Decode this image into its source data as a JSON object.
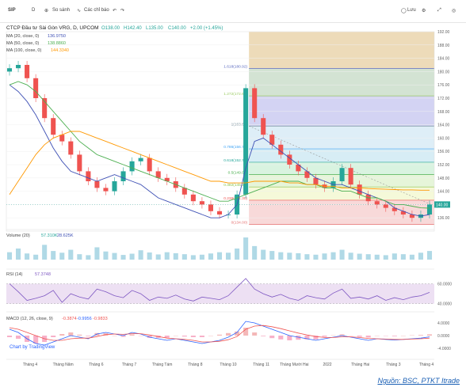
{
  "toolbar": {
    "symbol": "SIP",
    "interval": "D",
    "compare": "So sánh",
    "indicators": "Các chỉ báo",
    "save": "Lưu"
  },
  "chart_data": [
    {
      "type": "line",
      "title": "CTCP Đầu tư Sài Gòn VRG, D, UPCOM",
      "ohlc": {
        "open": "O138.00",
        "high": "H142.40",
        "low": "L135.00",
        "close": "C140.00",
        "change": "+2.00 (+1.45%)"
      },
      "ma_labels": [
        {
          "name": "MA (20, close, 0)",
          "value": "136.9750",
          "color": "#3f51b5"
        },
        {
          "name": "MA (50, close, 0)",
          "value": "138.8860",
          "color": "#4caf50"
        },
        {
          "name": "MA (100, close, 0)",
          "value": "144.3340",
          "color": "#ff9800"
        }
      ],
      "x_labels": [
        "Tháng 4",
        "Tháng Năm",
        "Tháng 6",
        "Tháng 7",
        "Tháng Tám",
        "Tháng 8",
        "Tháng 10",
        "Tháng 11",
        "Tháng Mười Hai",
        "2022",
        "Tháng Hai",
        "Tháng 3",
        "Tháng 4"
      ],
      "ylim": [
        132,
        192
      ],
      "y_ticks": [
        136,
        140,
        144,
        148,
        152,
        156,
        160,
        164,
        168,
        172,
        176,
        180,
        184,
        188,
        192
      ],
      "last_price_label": "140.00",
      "series": [
        {
          "name": "MA (20, close, 0)",
          "color": "#3f51b5",
          "values": [
            176,
            174,
            171,
            167,
            162,
            157,
            153,
            150,
            149,
            148,
            147,
            148,
            149,
            148,
            147,
            146,
            144,
            142,
            141,
            140,
            139,
            138,
            137,
            136,
            136,
            137,
            140,
            151,
            159,
            160,
            158,
            156,
            154,
            152,
            150,
            148,
            147,
            146,
            146,
            145,
            144,
            143,
            142,
            141,
            139,
            138,
            137,
            136.5,
            137
          ]
        },
        {
          "name": "MA (50, close, 0)",
          "color": "#4caf50",
          "values": [
            176,
            177,
            176,
            174,
            171,
            168,
            165,
            162,
            159,
            157,
            155,
            154,
            153,
            152,
            151,
            150,
            149,
            148,
            147,
            146,
            145,
            144,
            143,
            142,
            141,
            141,
            142,
            143,
            144,
            145,
            146,
            147,
            147,
            147,
            146,
            146,
            145,
            145,
            144,
            144,
            143,
            142,
            142,
            141,
            140,
            140,
            139.5,
            139,
            138.9
          ]
        },
        {
          "name": "MA (100, close, 0)",
          "color": "#ff9800",
          "values": [
            143,
            147,
            151,
            155,
            158,
            160,
            161,
            162,
            162,
            161,
            160,
            159,
            158,
            157,
            156,
            155,
            154,
            153,
            152,
            151,
            150,
            149,
            148,
            147,
            147,
            146.5,
            146.5,
            146.5,
            147,
            147,
            147,
            147,
            146.5,
            146.5,
            146,
            146,
            145.5,
            145.5,
            145,
            145,
            145,
            144.8,
            144.7,
            144.6,
            144.5,
            144.4,
            144.4,
            144.3,
            144.3
          ]
        }
      ],
      "close_path": [
        181,
        182,
        178,
        172,
        166,
        161,
        159,
        155,
        150,
        147,
        145,
        144,
        147,
        150,
        153,
        154,
        150,
        148,
        147,
        145,
        143,
        141,
        140,
        138,
        137,
        137,
        143,
        175,
        166,
        161,
        158,
        155,
        152,
        150,
        148,
        146,
        145,
        147,
        151,
        146,
        143,
        141,
        140,
        139,
        138,
        137,
        136,
        137,
        140
      ],
      "fibonacci": [
        {
          "label": "1.618(180.92)",
          "value": 180.92,
          "color": "#5c6bc0"
        },
        {
          "label": "1.272(172.69)",
          "value": 172.69,
          "color": "#9ccc65"
        },
        {
          "label": "1(163.60)",
          "value": 163.6,
          "color": "#78909c"
        },
        {
          "label": "0.786(156.75)",
          "value": 156.75,
          "color": "#42a5f5"
        },
        {
          "label": "0.618(152.73)",
          "value": 152.73,
          "color": "#26a69a"
        },
        {
          "label": "0.5(149.00)",
          "value": 149.0,
          "color": "#4caf50"
        },
        {
          "label": "0.382(145.29)",
          "value": 145.29,
          "color": "#8bc34a"
        },
        {
          "label": "0.236(141.30)",
          "value": 141.3,
          "color": "#ef5350"
        },
        {
          "label": "0(134.00)",
          "value": 134.0,
          "color": "#e57373"
        }
      ],
      "fib_top_value": 192,
      "volume": {
        "label": "Volume (20)",
        "value1": "57.310K",
        "value2": "28.625K",
        "bars": [
          30,
          45,
          25,
          20,
          60,
          35,
          28,
          40,
          22,
          18,
          50,
          33,
          27,
          19,
          24,
          38,
          29,
          21,
          30,
          26,
          22,
          18,
          20,
          25,
          30,
          28,
          45,
          90,
          55,
          40,
          35,
          30,
          28,
          26,
          22,
          20,
          25,
          30,
          40,
          28,
          24,
          22,
          20,
          18,
          25,
          22,
          20,
          28,
          35
        ]
      },
      "rsi": {
        "label": "RSI (14)",
        "value": "57.3748",
        "levels": [
          70.0,
          40.0
        ],
        "level_labels": [
          "60.0000",
          "40.0000"
        ],
        "values": [
          70,
          58,
          45,
          48,
          52,
          60,
          42,
          55,
          50,
          47,
          62,
          58,
          52,
          49,
          60,
          55,
          45,
          50,
          48,
          53,
          47,
          44,
          50,
          48,
          46,
          52,
          65,
          78,
          62,
          55,
          50,
          54,
          48,
          45,
          52,
          49,
          47,
          56,
          62,
          48,
          50,
          47,
          52,
          45,
          49,
          46,
          50,
          52,
          57
        ]
      },
      "macd": {
        "label": "MACD (12, 26, close, 9)",
        "macd": "-0.3874",
        "signal": "-0.9956",
        "hist": "-0.9833",
        "y_labels": [
          "4.0000",
          "0.0000",
          "-4.0000"
        ],
        "macd_values": [
          2,
          1,
          -1,
          -2.5,
          -3,
          -2,
          -1,
          0,
          -0.5,
          -1,
          0.5,
          1,
          0.5,
          0,
          1,
          0.5,
          -0.5,
          -1,
          -1.5,
          -1,
          -1.5,
          -2,
          -2.5,
          -2,
          -1.5,
          -0.5,
          1,
          4.5,
          4,
          3,
          2,
          1,
          0,
          -0.5,
          -1,
          -1.5,
          -1,
          -0.5,
          0,
          -0.5,
          -1,
          -1.5,
          -1,
          -1.2,
          -1.4,
          -1.2,
          -1,
          -0.8,
          -0.4
        ],
        "signal_values": [
          2.5,
          2,
          1,
          0,
          -1,
          -1.5,
          -1.5,
          -1,
          -0.8,
          -0.8,
          -0.3,
          0.3,
          0.5,
          0.4,
          0.6,
          0.6,
          0.2,
          -0.3,
          -0.8,
          -1,
          -1.2,
          -1.5,
          -2,
          -2,
          -1.8,
          -1.3,
          -0.3,
          2,
          3,
          3.2,
          2.8,
          2.2,
          1.5,
          0.8,
          0.2,
          -0.3,
          -0.6,
          -0.6,
          -0.4,
          -0.4,
          -0.6,
          -0.9,
          -1,
          -1.1,
          -1.2,
          -1.2,
          -1.1,
          -1,
          -0.8
        ]
      },
      "watermark": "Chart by TradingView"
    }
  ],
  "source": "Nguồn: BSC, PTKT Itrade"
}
